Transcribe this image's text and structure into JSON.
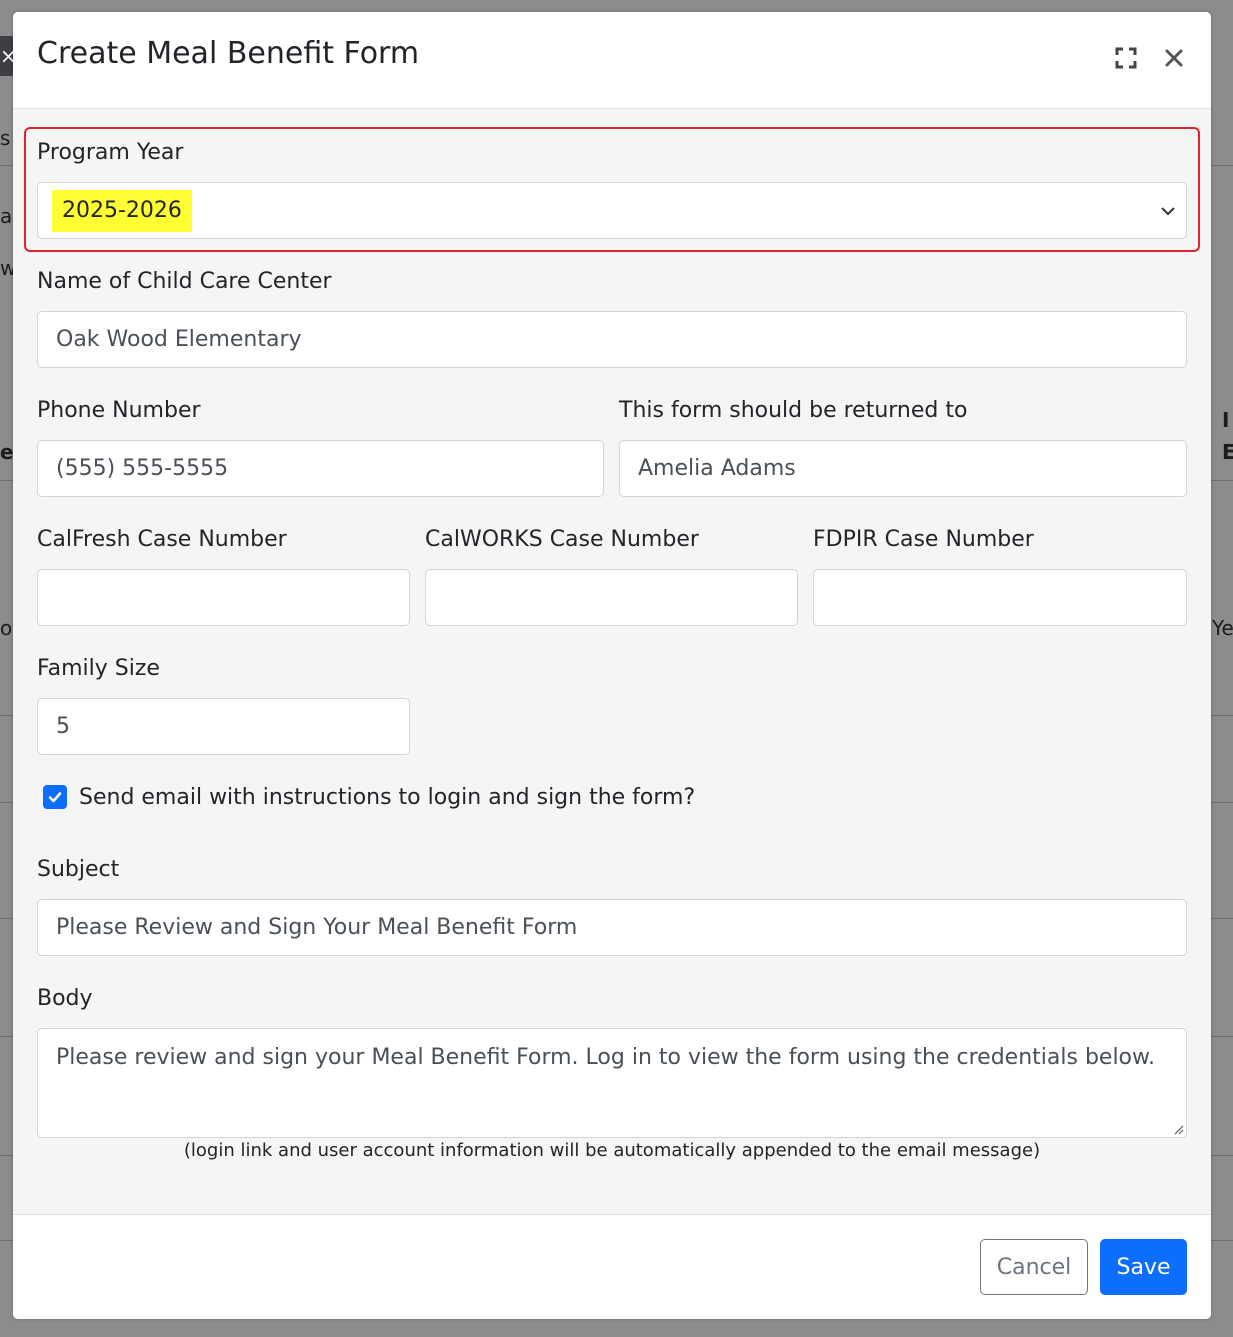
{
  "background": {
    "close_glyph": "×",
    "fragments": [
      "s",
      "al",
      "w",
      "ea",
      "ol",
      "I",
      "E",
      "Ye"
    ]
  },
  "modal": {
    "title": "Create Meal Benefit Form",
    "header_icons": [
      "expand-icon",
      "close-icon"
    ]
  },
  "form": {
    "program_year": {
      "label": "Program Year",
      "value": "2025-2026"
    },
    "center_name": {
      "label": "Name of Child Care Center",
      "value": "Oak Wood Elementary"
    },
    "phone": {
      "label": "Phone Number",
      "value": "(555) 555-5555"
    },
    "return_to": {
      "label": "This form should be returned to",
      "value": "Amelia Adams"
    },
    "calfresh": {
      "label": "CalFresh Case Number",
      "value": ""
    },
    "calworks": {
      "label": "CalWORKS Case Number",
      "value": ""
    },
    "fdpir": {
      "label": "FDPIR Case Number",
      "value": ""
    },
    "family_size": {
      "label": "Family Size",
      "value": "5"
    },
    "send_email": {
      "label": "Send email with instructions to login and sign the form?",
      "checked": true
    },
    "subject": {
      "label": "Subject",
      "value": "Please Review and Sign Your Meal Benefit Form"
    },
    "body": {
      "label": "Body",
      "value": "Please review and sign your Meal Benefit Form. Log in to view the form using the credentials below.",
      "hint": "(login link and user account information will be automatically appended to the email message)"
    }
  },
  "footer": {
    "cancel_label": "Cancel",
    "save_label": "Save"
  },
  "colors": {
    "primary": "#0d6efd",
    "highlight": "#ffff33",
    "annotation": "#e1252f"
  }
}
